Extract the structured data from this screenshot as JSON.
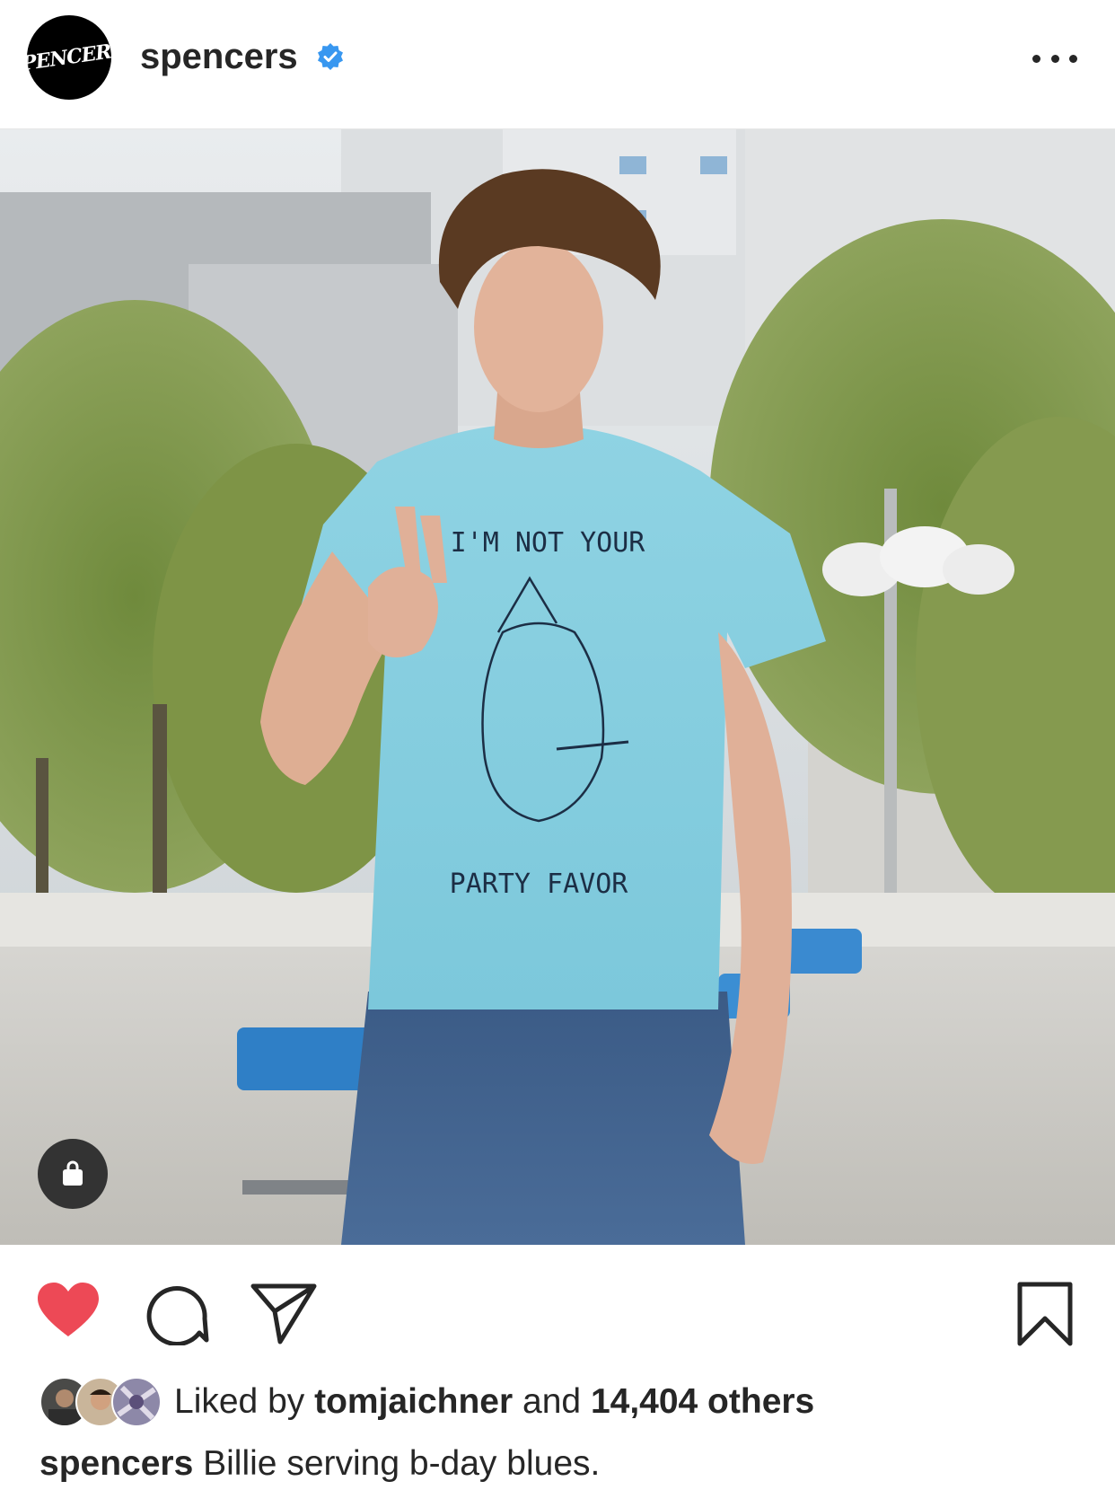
{
  "header": {
    "avatar_logo_text": "SPENCER'S",
    "username": "spencers",
    "verified_icon": "verified-badge-icon",
    "more_icon": "more-options-icon"
  },
  "photo": {
    "shirt_text_top": "I'M NOT YOUR",
    "shirt_text_bottom": "PARTY FAVOR",
    "shop_icon": "shopping-bag-icon"
  },
  "actions": {
    "like_icon": "heart-icon",
    "like_color": "#ed4956",
    "comment_icon": "comment-icon",
    "share_icon": "send-icon",
    "save_icon": "bookmark-icon"
  },
  "likes": {
    "prefix": "Liked by",
    "first_liker": "tomjaichner",
    "connector": "and",
    "others": "14,404 others"
  },
  "caption": {
    "username": "spencers",
    "text": "Billie serving b-day blues."
  }
}
